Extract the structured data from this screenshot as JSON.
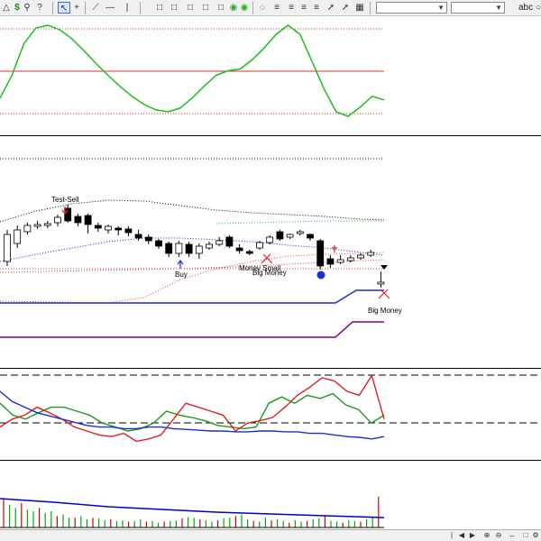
{
  "toolbar": {
    "items_left": [
      "binoculars-icon",
      "dollar-icon",
      "search-icon",
      "help-cursor-icon"
    ],
    "items_draw": [
      "pointer-icon",
      "crosshair-icon",
      "trendline-icon",
      "hline-icon",
      "vline-icon"
    ],
    "items_view": [
      "panel1-icon",
      "panel2-icon",
      "panel3-icon",
      "panel4-icon",
      "panel5-icon",
      "refresh-icon",
      "refresh2-icon"
    ],
    "items_tools": [
      "fan-icon",
      "fib-icon",
      "channel-icon",
      "pitchfork-icon",
      "gann-icon",
      "arrow-icon",
      "cycle-icon",
      "grid-icon"
    ],
    "select1_value": "",
    "select2_value": "",
    "abc_label": "abc"
  },
  "colors": {
    "oscillator": "#1ac01a",
    "midline": "#e03030",
    "band_red": "#e04040",
    "band_green": "#30c030",
    "band_black": "#000000",
    "band_blue": "#2020c0",
    "blue_line": "#1a2fd0",
    "purple_line": "#800080",
    "vol_blue": "#0000cc",
    "vol_red": "#cc0000",
    "vol_green": "#00aa00"
  },
  "annotations": {
    "test_sell": "Test-Sell",
    "buy": "Buy",
    "money_small": "Money Small",
    "big_money_1": "Big Money",
    "big_money_2": "Big Money"
  },
  "chart_data": [
    {
      "type": "line",
      "panel": "oscillator",
      "series": [
        {
          "values": [
            0.2,
            0.45,
            0.8,
            0.97,
            1.0,
            0.95,
            0.85,
            0.72,
            0.58,
            0.45,
            0.33,
            0.22,
            0.13,
            0.07,
            0.05,
            0.09,
            0.2,
            0.33,
            0.45,
            0.5,
            0.52,
            0.62,
            0.75,
            0.9,
            1.0,
            0.9,
            0.6,
            0.3,
            0.05,
            0.0,
            0.1,
            0.22,
            0.18
          ]
        }
      ]
    },
    {
      "type": "candlestick",
      "panel": "price",
      "candles": [
        {
          "o": 5,
          "c": 35,
          "h": 40,
          "l": 0
        },
        {
          "o": 25,
          "c": 40,
          "h": 45,
          "l": 20
        },
        {
          "o": 38,
          "c": 45,
          "h": 48,
          "l": 35
        },
        {
          "o": 44,
          "c": 46,
          "h": 50,
          "l": 41
        },
        {
          "o": 45,
          "c": 47,
          "h": 50,
          "l": 42
        },
        {
          "o": 48,
          "c": 54,
          "h": 57,
          "l": 44
        },
        {
          "o": 64,
          "c": 50,
          "h": 68,
          "l": 48
        },
        {
          "o": 55,
          "c": 48,
          "h": 58,
          "l": 44
        },
        {
          "o": 56,
          "c": 46,
          "h": 58,
          "l": 36
        },
        {
          "o": 45,
          "c": 42,
          "h": 48,
          "l": 38
        },
        {
          "o": 40,
          "c": 44,
          "h": 46,
          "l": 36
        },
        {
          "o": 42,
          "c": 40,
          "h": 44,
          "l": 34
        },
        {
          "o": 41,
          "c": 37,
          "h": 44,
          "l": 33
        },
        {
          "o": 35,
          "c": 31,
          "h": 40,
          "l": 28
        },
        {
          "o": 32,
          "c": 28,
          "h": 35,
          "l": 24
        },
        {
          "o": 28,
          "c": 22,
          "h": 30,
          "l": 19
        },
        {
          "o": 25,
          "c": 14,
          "h": 27,
          "l": 10
        },
        {
          "o": 14,
          "c": 25,
          "h": 28,
          "l": 10
        },
        {
          "o": 24,
          "c": 14,
          "h": 27,
          "l": 10
        },
        {
          "o": 14,
          "c": 22,
          "h": 25,
          "l": 8
        },
        {
          "o": 20,
          "c": 24,
          "h": 27,
          "l": 18
        },
        {
          "o": 24,
          "c": 28,
          "h": 32,
          "l": 22
        },
        {
          "o": 32,
          "c": 22,
          "h": 34,
          "l": 20
        },
        {
          "o": 20,
          "c": 17,
          "h": 24,
          "l": 14
        },
        {
          "o": 16,
          "c": 14,
          "h": 18,
          "l": 12
        },
        {
          "o": 20,
          "c": 26,
          "h": 28,
          "l": 18
        },
        {
          "o": 26,
          "c": 32,
          "h": 34,
          "l": 24
        },
        {
          "o": 38,
          "c": 30,
          "h": 40,
          "l": 28
        },
        {
          "o": 32,
          "c": 35,
          "h": 36,
          "l": 30
        },
        {
          "o": 36,
          "c": 38,
          "h": 40,
          "l": 34
        },
        {
          "o": 35,
          "c": 31,
          "h": 36,
          "l": 28
        },
        {
          "o": 28,
          "c": 0,
          "h": 30,
          "l": -4
        },
        {
          "o": 8,
          "c": 2,
          "h": 12,
          "l": -2
        },
        {
          "o": 4,
          "c": 7,
          "h": 12,
          "l": 2
        },
        {
          "o": 6,
          "c": 9,
          "h": 12,
          "l": 4
        },
        {
          "o": 9,
          "c": 12,
          "h": 14,
          "l": 7
        },
        {
          "o": 12,
          "c": 15,
          "h": 18,
          "l": 10
        },
        {
          "o": -20,
          "c": -18,
          "h": -6,
          "l": -24
        }
      ]
    },
    {
      "type": "line",
      "panel": "lower-oscillator",
      "series": [
        {
          "values": [
            0.6,
            0.45,
            0.4,
            0.48,
            0.55,
            0.55,
            0.5,
            0.45,
            0.35,
            0.3,
            0.25,
            0.28,
            0.35,
            0.5,
            0.45,
            0.42,
            0.38,
            0.32,
            0.3,
            0.28,
            0.3,
            0.6,
            0.68,
            0.6,
            0.7,
            0.66,
            0.72,
            0.58,
            0.52,
            0.35,
            0.45
          ]
        },
        {
          "values": [
            0.3,
            0.4,
            0.45,
            0.55,
            0.48,
            0.4,
            0.3,
            0.25,
            0.2,
            0.18,
            0.22,
            0.12,
            0.15,
            0.2,
            0.4,
            0.6,
            0.55,
            0.5,
            0.45,
            0.25,
            0.35,
            0.38,
            0.42,
            0.55,
            0.7,
            0.8,
            0.92,
            0.88,
            0.75,
            0.7,
            0.95,
            0.4
          ]
        },
        {
          "values": [
            0.75,
            0.62,
            0.55,
            0.48,
            0.44,
            0.4,
            0.36,
            0.32,
            0.3,
            0.3,
            0.28,
            0.28,
            0.3,
            0.3,
            0.28,
            0.27,
            0.26,
            0.25,
            0.25,
            0.24,
            0.24,
            0.25,
            0.25,
            0.24,
            0.24,
            0.22,
            0.22,
            0.2,
            0.18,
            0.17,
            0.15,
            0.18
          ]
        }
      ]
    },
    {
      "type": "bar",
      "panel": "volume",
      "values": [
        0.9,
        0.7,
        0.6,
        0.75,
        0.55,
        0.5,
        0.6,
        0.45,
        0.5,
        0.35,
        0.4,
        0.3,
        0.3,
        0.35,
        0.25,
        0.3,
        0.28,
        0.22,
        0.25,
        0.2,
        0.22,
        0.18,
        0.2,
        0.25,
        0.18,
        0.2,
        0.15,
        0.18,
        0.2,
        0.22,
        0.28,
        0.32,
        0.3,
        0.25,
        0.22,
        0.18,
        0.22,
        0.28,
        0.3,
        0.35,
        0.4,
        0.25,
        0.2,
        0.18,
        0.3,
        0.22,
        0.25,
        0.2,
        0.15,
        0.22,
        0.18,
        0.2,
        0.25,
        0.28,
        0.35,
        0.2,
        0.18,
        0.15,
        0.22,
        0.2,
        0.18,
        0.25,
        0.3,
        0.95
      ]
    }
  ]
}
